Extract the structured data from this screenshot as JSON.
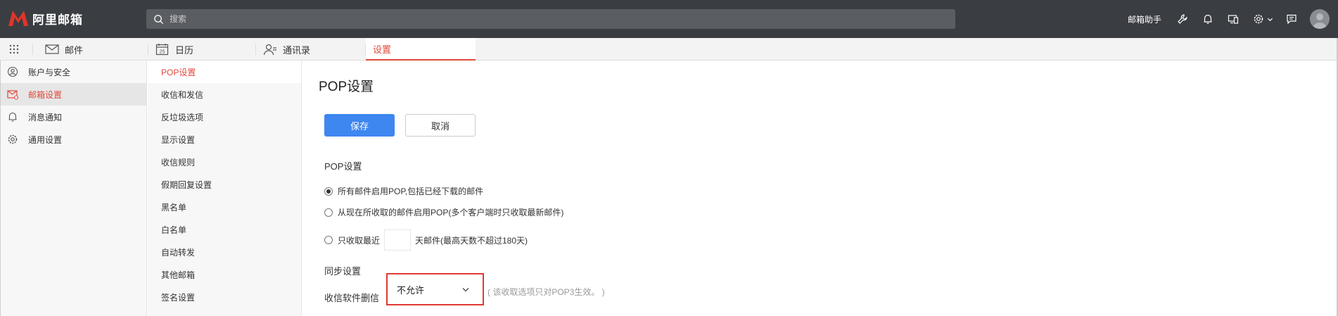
{
  "app": {
    "logo_text": "阿里邮箱",
    "brand_color": "#e04a3c"
  },
  "header": {
    "search_placeholder": "搜索",
    "assistant_label": "邮箱助手",
    "icons": [
      "wrench-icon",
      "bell-icon",
      "devices-icon",
      "gear-icon",
      "chevron-down-icon",
      "feedback-icon"
    ]
  },
  "tabs": [
    {
      "label": "邮件",
      "icon": "mail-icon"
    },
    {
      "label": "日历",
      "icon": "calendar-icon",
      "calendar_day": "25"
    },
    {
      "label": "通讯录",
      "icon": "contacts-icon"
    },
    {
      "label": "设置",
      "active": true
    }
  ],
  "sidebar": {
    "items": [
      {
        "label": "账户与安全",
        "icon": "user-circle-icon"
      },
      {
        "label": "邮箱设置",
        "icon": "mail-settings-icon",
        "active": true
      },
      {
        "label": "消息通知",
        "icon": "bell-icon"
      },
      {
        "label": "通用设置",
        "icon": "gear-icon"
      }
    ]
  },
  "subnav": {
    "items": [
      {
        "label": "POP设置",
        "active": true
      },
      {
        "label": "收信和发信"
      },
      {
        "label": "反垃圾选项"
      },
      {
        "label": "显示设置"
      },
      {
        "label": "收信规则"
      },
      {
        "label": "假期回复设置"
      },
      {
        "label": "黑名单"
      },
      {
        "label": "白名单"
      },
      {
        "label": "自动转发"
      },
      {
        "label": "其他邮箱"
      },
      {
        "label": "签名设置"
      }
    ]
  },
  "main": {
    "title": "POP设置",
    "save_label": "保存",
    "cancel_label": "取消",
    "pop_section_label": "POP设置",
    "radio_options": [
      {
        "label": "所有邮件启用POP,包括已经下载的邮件",
        "checked": true
      },
      {
        "label": "从现在所收取的邮件启用POP(多个客户端时只收取最新邮件)",
        "checked": false
      }
    ],
    "recent_option": {
      "prefix": "只收取最近",
      "days_value": "",
      "suffix": "天邮件(最高天数不超过180天)",
      "checked": false
    },
    "sync_section_label": "同步设置",
    "sync_delete_label": "收信软件删信",
    "sync_delete_value": "不允许",
    "sync_hint": "( 该收取选项只对POP3生效。 )"
  }
}
